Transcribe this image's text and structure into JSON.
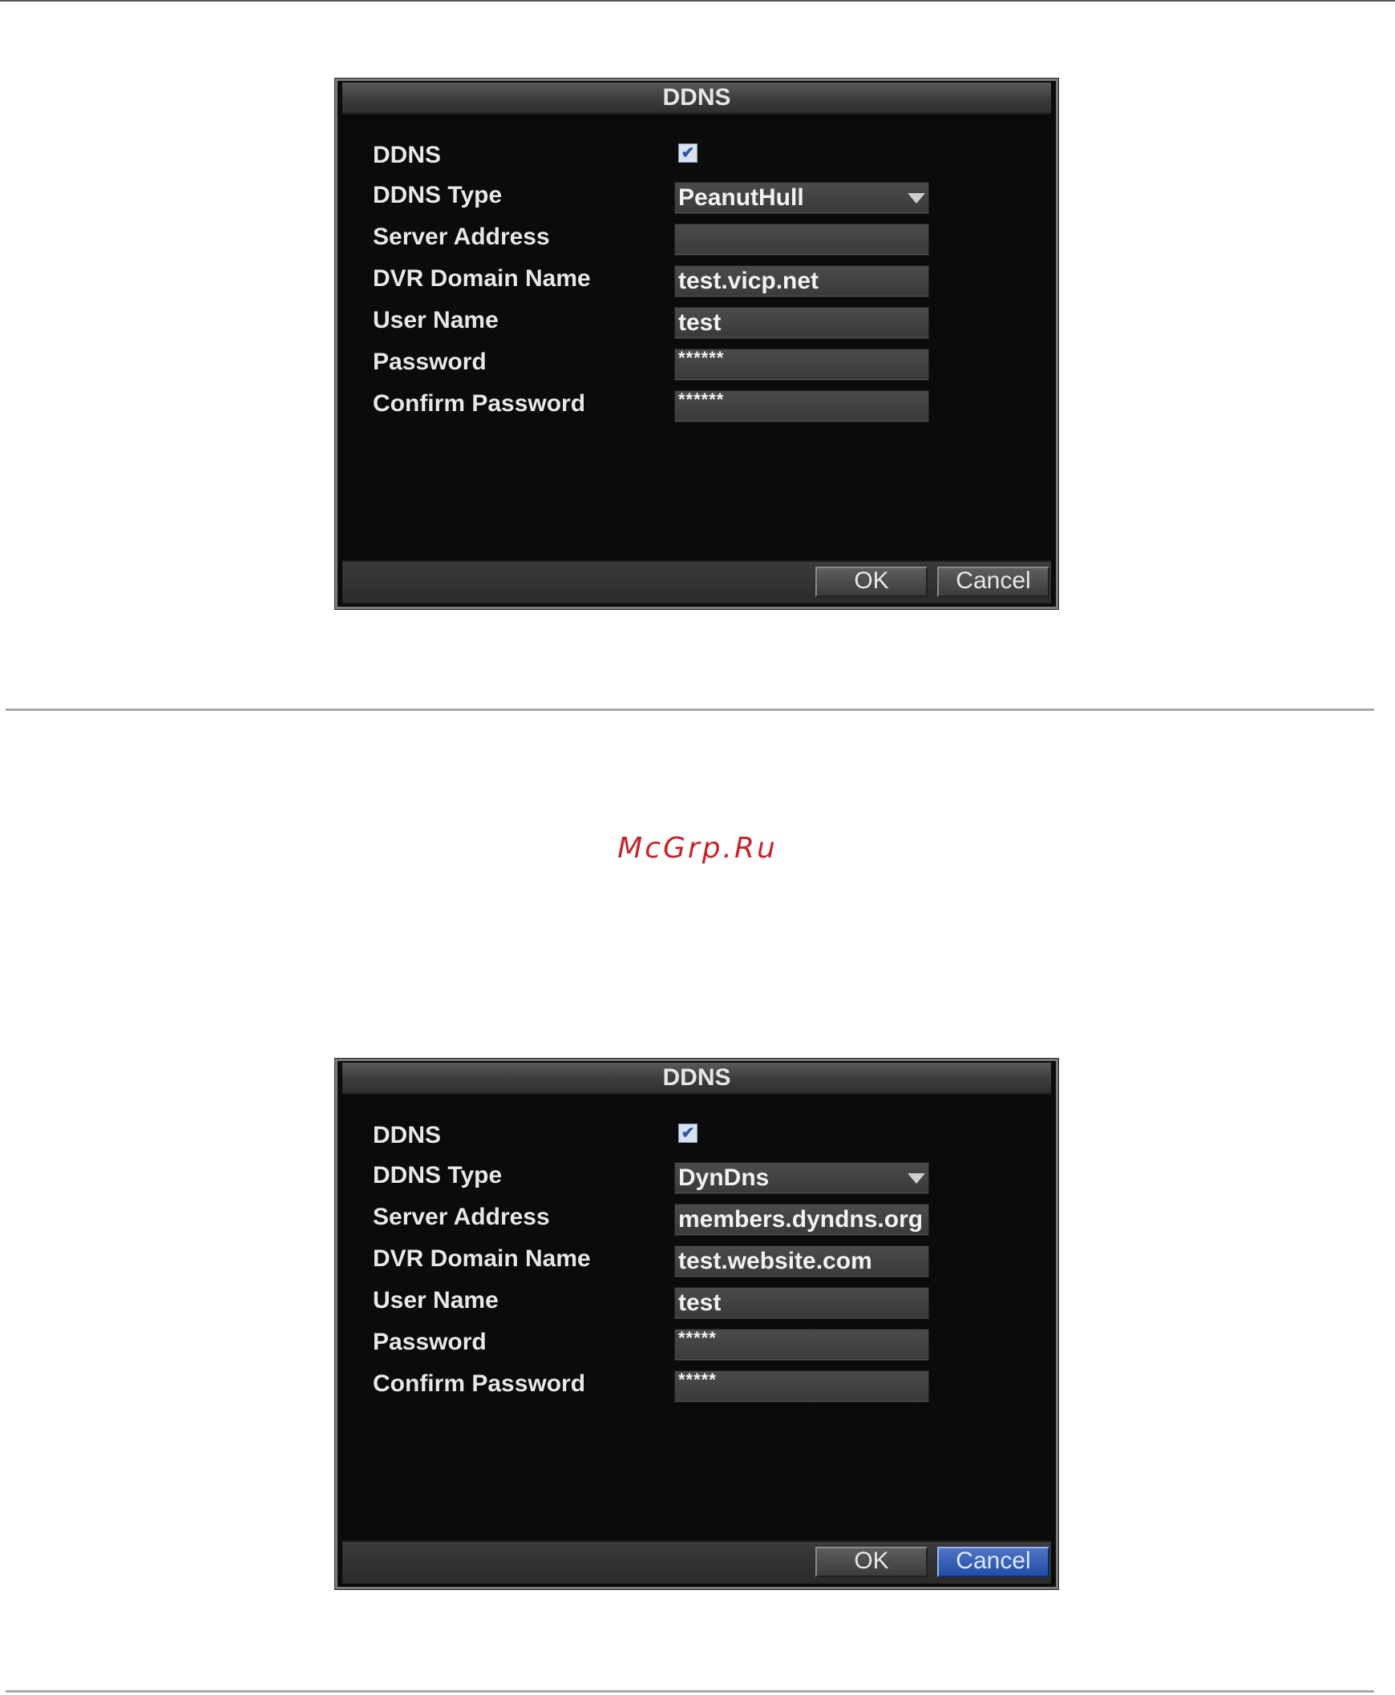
{
  "watermark": "McGrp.Ru",
  "dialogs": [
    {
      "title": "DDNS",
      "labels": {
        "ddns": "DDNS",
        "ddns_type": "DDNS Type",
        "server_address": "Server Address",
        "domain_name": "DVR Domain Name",
        "user_name": "User Name",
        "password": "Password",
        "confirm_password": "Confirm Password"
      },
      "ddns_enabled": true,
      "checkbox_mark": "✔",
      "values": {
        "ddns_type": "PeanutHull",
        "server_address": "",
        "domain_name": "test.vicp.net",
        "user_name": "test",
        "password": "******",
        "confirm_password": "******"
      },
      "buttons": {
        "ok": "OK",
        "cancel": "Cancel"
      },
      "focused_button": "none"
    },
    {
      "title": "DDNS",
      "labels": {
        "ddns": "DDNS",
        "ddns_type": "DDNS Type",
        "server_address": "Server Address",
        "domain_name": "DVR Domain Name",
        "user_name": "User Name",
        "password": "Password",
        "confirm_password": "Confirm Password"
      },
      "ddns_enabled": true,
      "checkbox_mark": "✔",
      "values": {
        "ddns_type": "DynDns",
        "server_address": "members.dyndns.org",
        "domain_name": "test.website.com",
        "user_name": "test",
        "password": "*****",
        "confirm_password": "*****"
      },
      "buttons": {
        "ok": "OK",
        "cancel": "Cancel"
      },
      "focused_button": "cancel"
    }
  ],
  "colors": {
    "dialog_bg": "#0b0b0b",
    "field_bg": "#444444",
    "focus_blue": "#2c5bb8",
    "watermark_red": "#c8242b"
  }
}
